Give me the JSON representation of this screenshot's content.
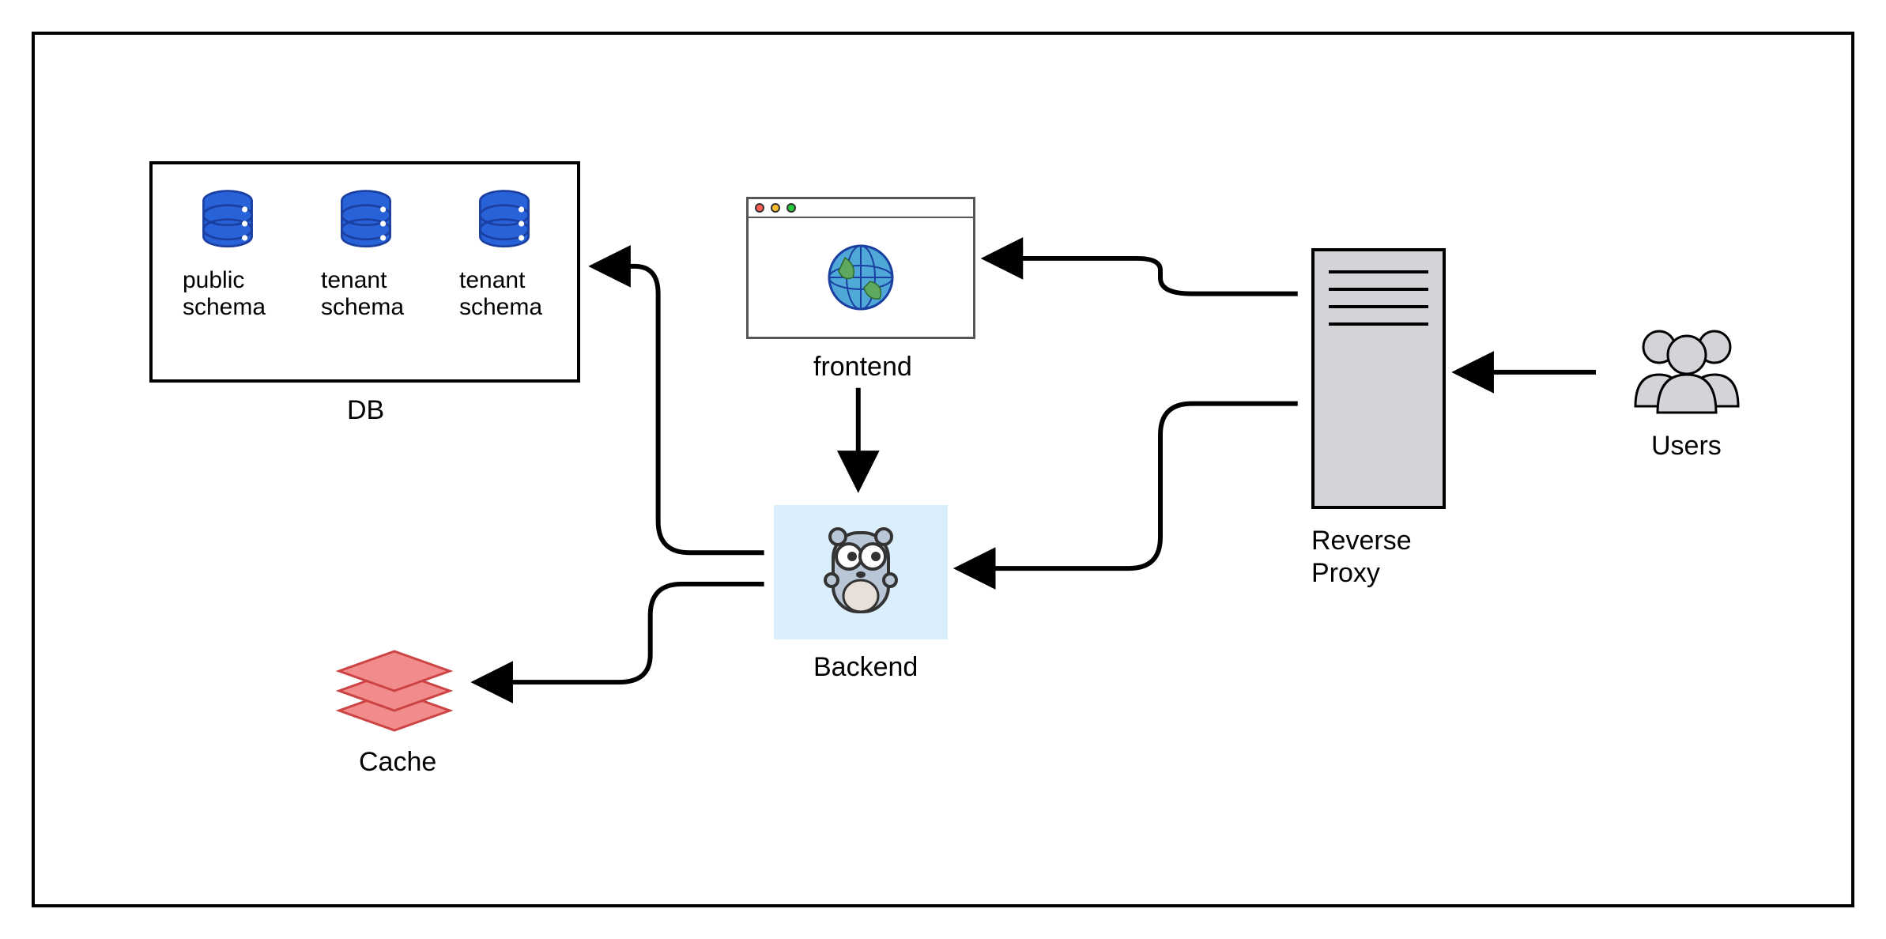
{
  "nodes": {
    "db": {
      "label": "DB",
      "schemas": [
        {
          "name": "public\nschema"
        },
        {
          "name": "tenant\nschema"
        },
        {
          "name": "tenant\nschema"
        }
      ]
    },
    "frontend": {
      "label": "frontend"
    },
    "backend": {
      "label": "Backend"
    },
    "reverse_proxy": {
      "label": "Reverse\nProxy"
    },
    "cache": {
      "label": "Cache"
    },
    "users": {
      "label": "Users"
    }
  },
  "edges": [
    {
      "from": "users",
      "to": "reverse_proxy"
    },
    {
      "from": "reverse_proxy",
      "to": "frontend"
    },
    {
      "from": "reverse_proxy",
      "to": "backend"
    },
    {
      "from": "frontend",
      "to": "backend"
    },
    {
      "from": "backend",
      "to": "db"
    },
    {
      "from": "backend",
      "to": "cache"
    }
  ]
}
